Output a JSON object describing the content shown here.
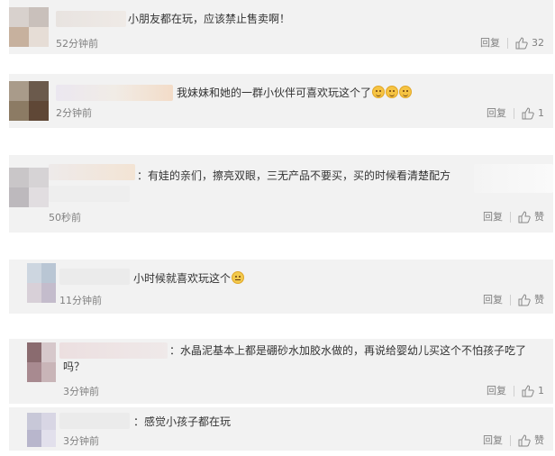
{
  "comments": [
    {
      "text": "小朋友都在玩，应该禁止售卖啊！",
      "time": "52分钟前",
      "reply_label": "回复",
      "likes": "32",
      "avatar_colors": [
        "#d8d1cd",
        "#c9c0bb",
        "#c7b19e",
        "#e6ddd6"
      ]
    },
    {
      "text": "我妹妹和她的一群小伙伴可喜欢玩这个了",
      "emojis": [
        "smile-emoji",
        "smile-emoji",
        "smile-emoji"
      ],
      "time": "2分钟前",
      "reply_label": "回复",
      "likes": "1",
      "avatar_colors": [
        "#a99b8a",
        "#6b5a4c",
        "#8c7b64",
        "#5f4736"
      ]
    },
    {
      "text": "：有娃的亲们，擦亮双眼，三无产品不要买，买的时候看清楚配方",
      "time": "50秒前",
      "reply_label": "回复",
      "likes": "赞",
      "avatar_colors": [
        "#c9c6c8",
        "#d6d3d5",
        "#bdb9bd",
        "#e1dde0"
      ]
    },
    {
      "text": "小时候就喜欢玩这个",
      "emojis": [
        "cry-laugh-emoji"
      ],
      "time": "11分钟前",
      "reply_label": "回复",
      "likes": "赞",
      "avatar_colors": [
        "#cdd6e0",
        "#b9c6d4",
        "#d8d0d8",
        "#c4bccc"
      ]
    },
    {
      "text": "：水晶泥基本上都是硼砂水加胶水做的，再说给婴幼儿买这个不怕孩子吃了吗？",
      "time": "3分钟前",
      "reply_label": "回复",
      "likes": "1",
      "avatar_colors": [
        "#8a6b6f",
        "#d6c8cb",
        "#a88a90",
        "#c9b5b8"
      ]
    },
    {
      "text": "：感觉小孩子都在玩",
      "time": "3分钟前",
      "reply_label": "回复",
      "likes": "赞",
      "avatar_colors": [
        "#c8c8d8",
        "#d8d6e4",
        "#b8b6cc",
        "#e2e0ec"
      ]
    }
  ]
}
